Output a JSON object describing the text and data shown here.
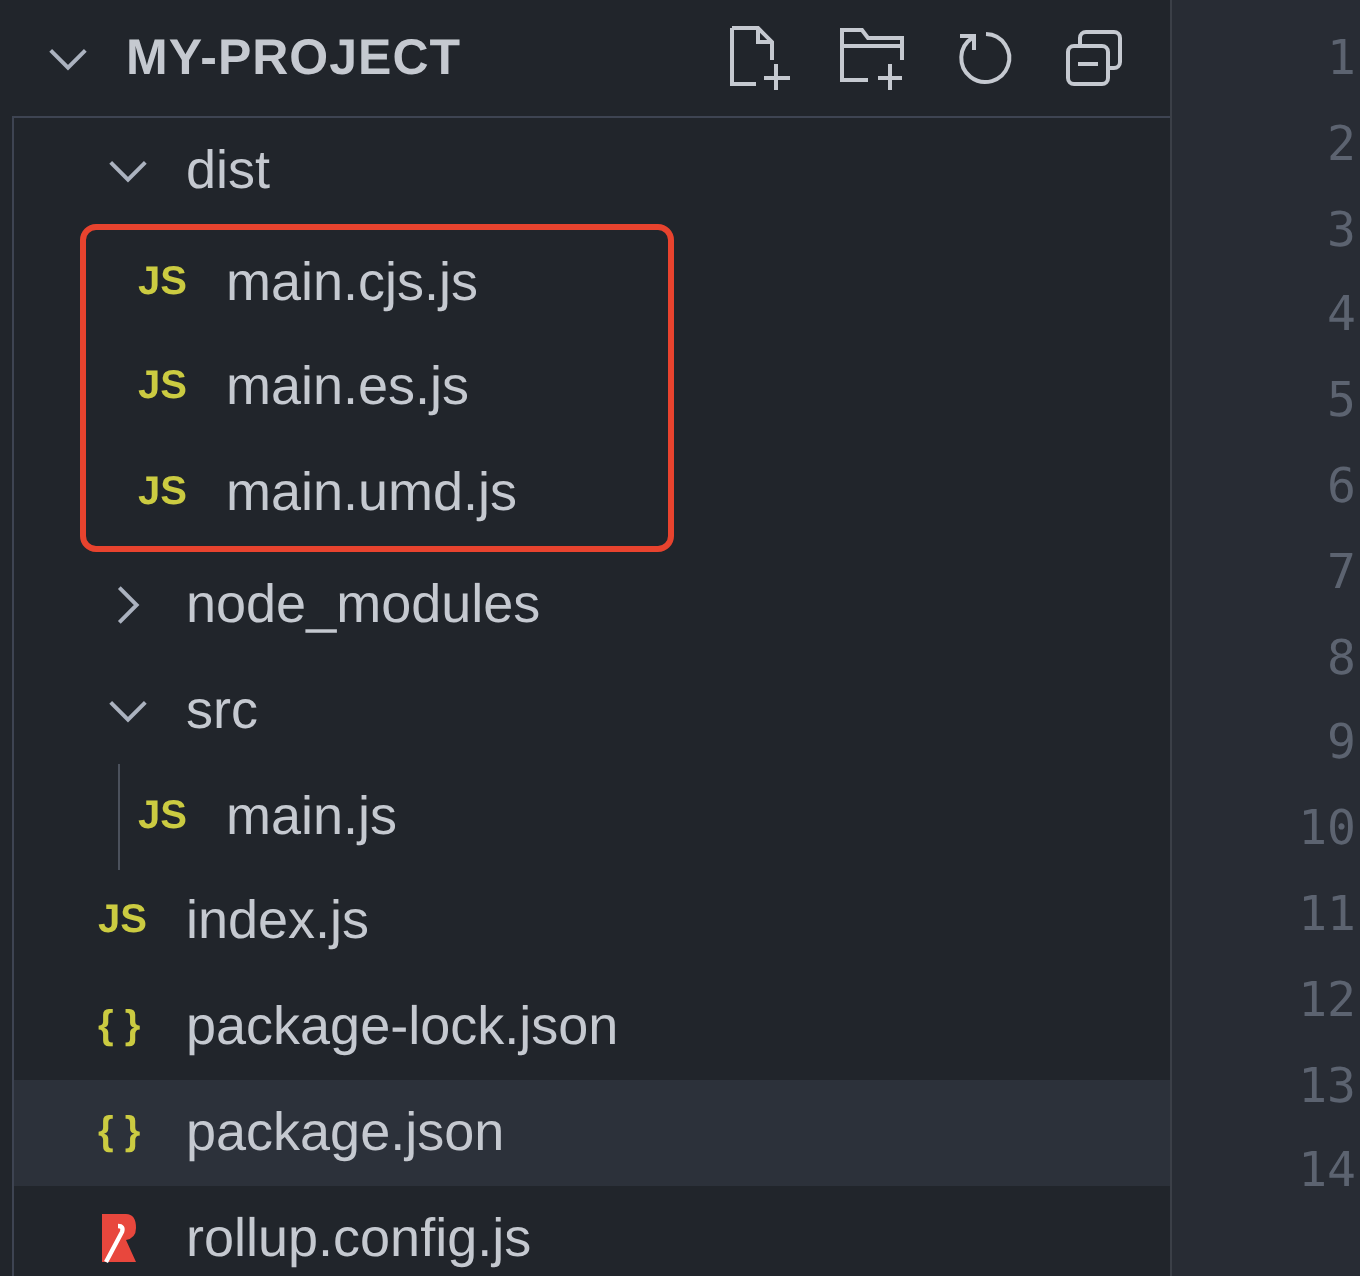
{
  "explorer": {
    "title": "MY-PROJECT",
    "expanded": true,
    "tree": [
      {
        "kind": "folder",
        "label": "dist",
        "expanded": true,
        "selected": false,
        "highlight_children": true,
        "children": [
          {
            "kind": "file",
            "icon": "JS",
            "label": "main.cjs.js",
            "selected": false
          },
          {
            "kind": "file",
            "icon": "JS",
            "label": "main.es.js",
            "selected": false
          },
          {
            "kind": "file",
            "icon": "JS",
            "label": "main.umd.js",
            "selected": false
          }
        ]
      },
      {
        "kind": "folder",
        "label": "node_modules",
        "expanded": false,
        "selected": false
      },
      {
        "kind": "folder",
        "label": "src",
        "expanded": true,
        "selected": false,
        "children": [
          {
            "kind": "file",
            "icon": "JS",
            "label": "main.js",
            "selected": false
          }
        ]
      },
      {
        "kind": "file",
        "icon": "JS",
        "label": "index.js",
        "selected": false
      },
      {
        "kind": "file",
        "icon": "{ }",
        "label": "package-lock.json",
        "selected": false
      },
      {
        "kind": "file",
        "icon": "{ }",
        "label": "package.json",
        "selected": true
      },
      {
        "kind": "rollup",
        "label": "rollup.config.js",
        "selected": false
      }
    ]
  },
  "line_numbers": [
    "1",
    "2",
    "3",
    "4",
    "5",
    "6",
    "7",
    "8",
    "9",
    "10",
    "11",
    "12",
    "13",
    "14"
  ]
}
